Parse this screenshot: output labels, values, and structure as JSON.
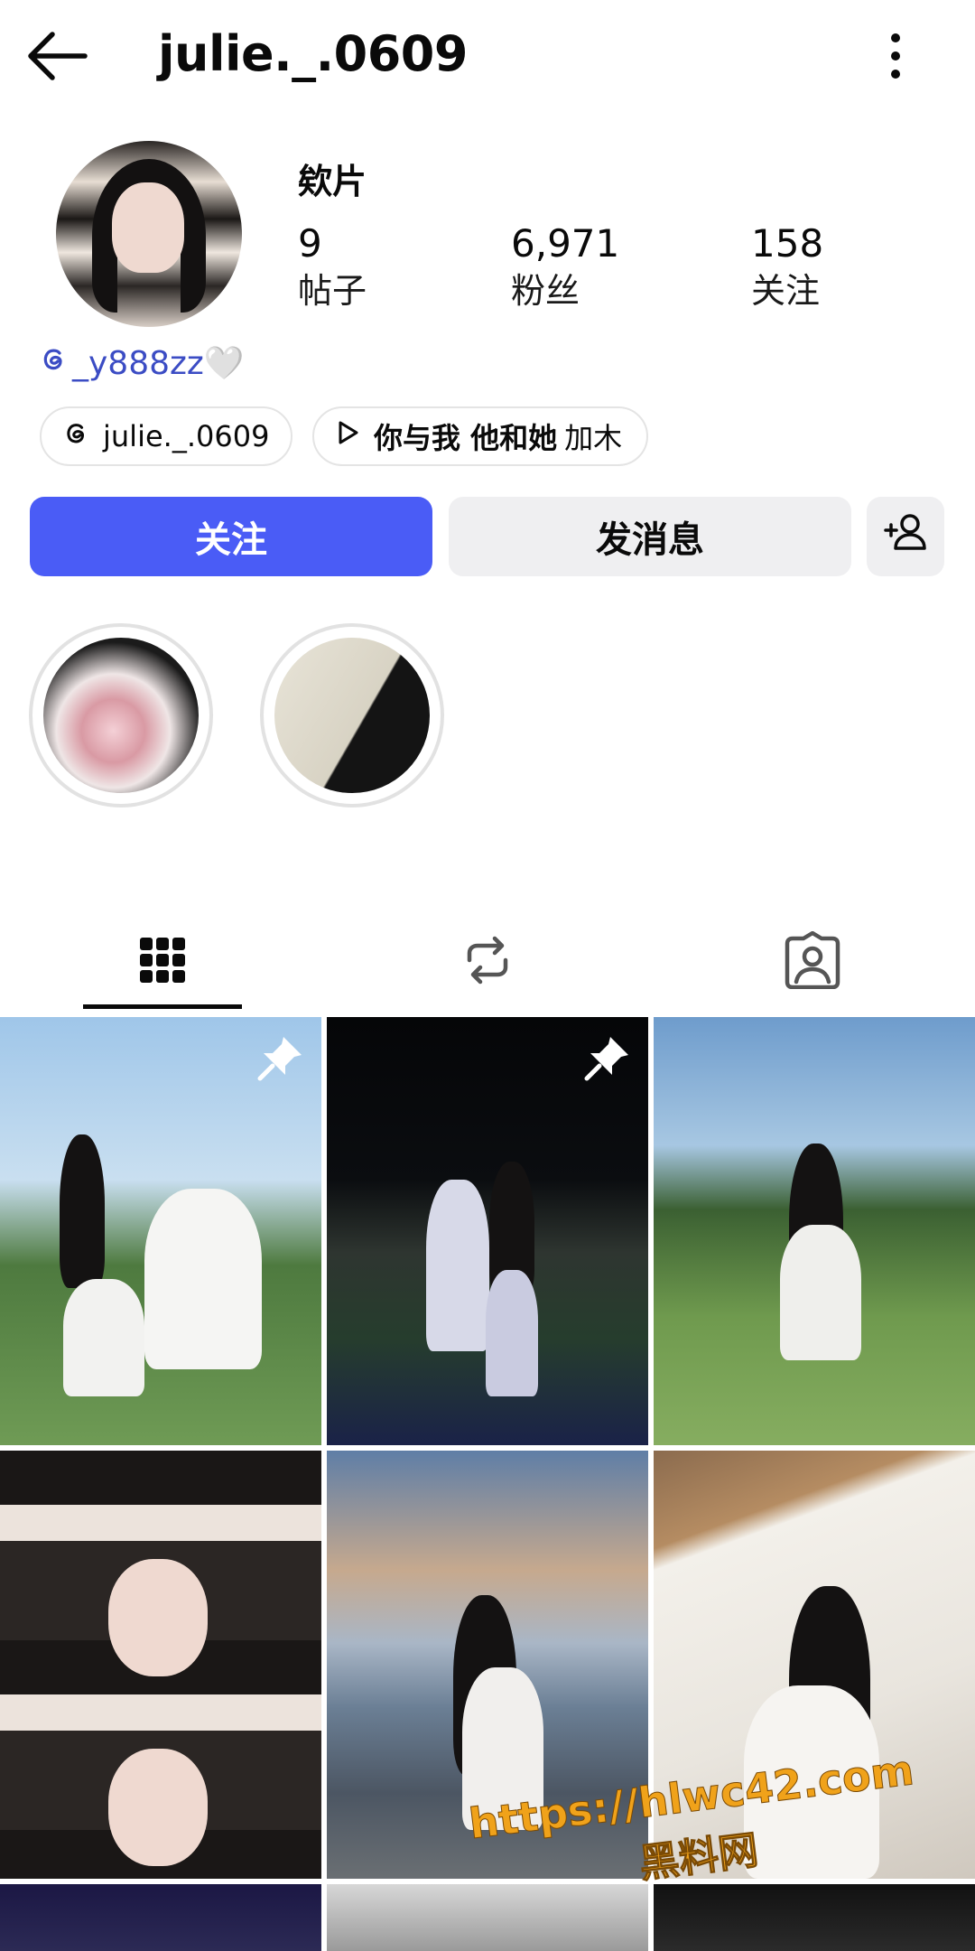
{
  "header": {
    "username": "julie._.0609"
  },
  "profile": {
    "display_name": "欸片",
    "stats": [
      {
        "value": "9",
        "label": "帖子"
      },
      {
        "value": "6,971",
        "label": "粉丝"
      },
      {
        "value": "158",
        "label": "关注"
      }
    ],
    "threads_handle": "_y888zz🤍",
    "chips": [
      {
        "label": "julie._.0609",
        "icon": "threads-icon"
      },
      {
        "label": "你与我 他和她",
        "extra": "加木",
        "icon": "play-icon"
      }
    ]
  },
  "actions": {
    "follow": "关注",
    "message": "发消息"
  },
  "highlights": [
    {
      "id": "hl-1"
    },
    {
      "id": "hl-2"
    }
  ],
  "tabs": [
    {
      "icon": "grid-icon"
    },
    {
      "icon": "reposts-icon"
    },
    {
      "icon": "tagged-icon"
    }
  ],
  "posts": [
    {
      "pinned": true
    },
    {
      "pinned": true
    },
    {
      "pinned": false
    },
    {
      "pinned": false
    },
    {
      "pinned": false
    },
    {
      "pinned": false
    },
    {
      "pinned": false
    },
    {
      "pinned": false
    },
    {
      "pinned": false
    }
  ],
  "watermark": {
    "url": "https://hlwc42.com",
    "text": "黑料网"
  },
  "colors": {
    "accent": "#4a5cf6",
    "link": "#3b4cc4",
    "watermark": "#f0a21a"
  }
}
